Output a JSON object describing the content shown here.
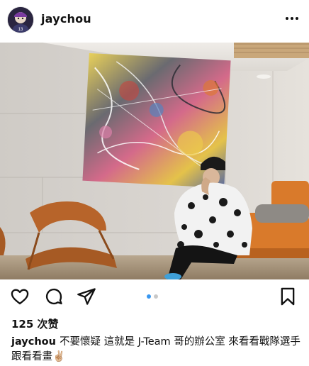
{
  "post": {
    "username": "jaychou",
    "likes_text": "125 次赞",
    "caption_user": "jaychou",
    "caption_text": "不要懷疑 這就是 J-Team 哥的辦公室 來看看戰隊選手跟看看畫✌🏼"
  },
  "icons": {
    "more": "more-horizontal-icon",
    "like": "heart-icon",
    "comment": "comment-icon",
    "share": "send-icon",
    "save": "bookmark-icon"
  },
  "carousel": {
    "count": 2,
    "active_index": 0
  },
  "colors": {
    "text": "#111111",
    "carousel_active": "#3897f0",
    "carousel_inactive": "#c8c8c8",
    "sofa": "#d97a2b"
  }
}
